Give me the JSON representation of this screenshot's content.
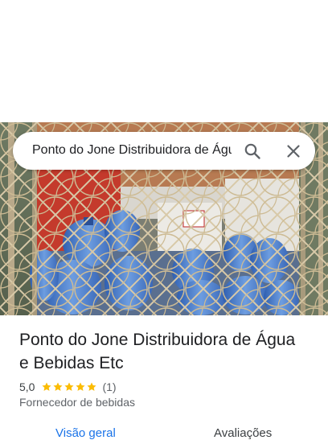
{
  "search": {
    "query": "Ponto do Jone Distribuidora de Água"
  },
  "place": {
    "title": "Ponto do Jone Distribuidora de Água e Bebidas Etc",
    "rating": "5,0",
    "stars": 5,
    "review_count": "(1)",
    "category": "Fornecedor de bebidas"
  },
  "tabs": [
    {
      "label": "Visão geral",
      "selected": true
    },
    {
      "label": "Avaliações",
      "selected": false
    }
  ],
  "colors": {
    "star": "#fbbc04",
    "accent": "#1a73e8"
  },
  "icons": [
    "search-icon",
    "close-icon",
    "star-icon"
  ]
}
